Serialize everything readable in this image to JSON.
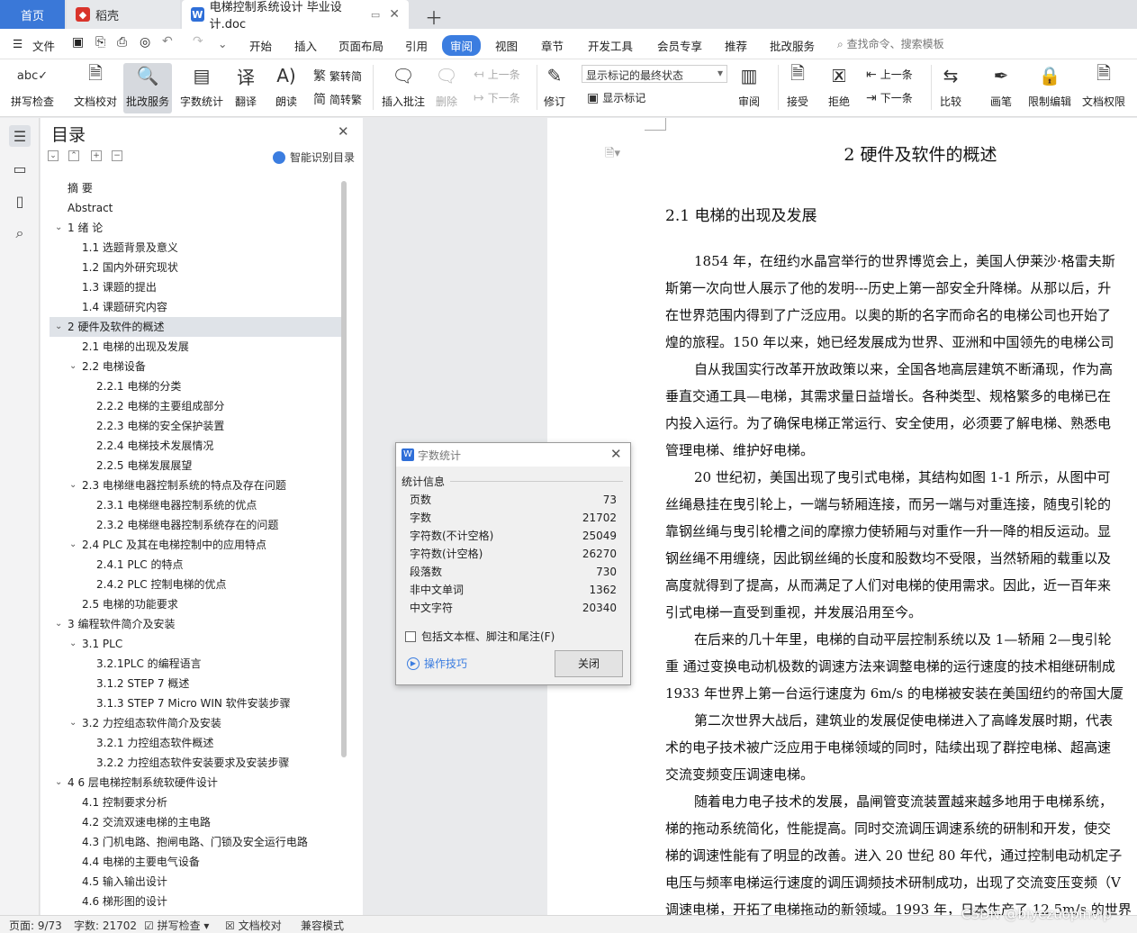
{
  "tabs": {
    "home": "首页",
    "daoke": "稻壳",
    "doc": "电梯控制系统设计 毕业设计.doc"
  },
  "menu": {
    "file": "文件",
    "items": [
      "开始",
      "插入",
      "页面布局",
      "引用",
      "审阅",
      "视图",
      "章节",
      "开发工具",
      "会员专享",
      "推荐",
      "批改服务"
    ],
    "active": "审阅",
    "search_placeholder": "查找命令、搜索模板"
  },
  "ribbon": {
    "spell_check": "拼写检查",
    "doc_proof": "文档校对",
    "correction_service": "批改服务",
    "word_count": "字数统计",
    "translate": "翻译",
    "read_aloud": "朗读",
    "trad_to_simp": "繁转简",
    "simp_to_trad": "简转繁",
    "insert_comment": "插入批注",
    "delete": "删除",
    "prev": "上一条",
    "next": "下一条",
    "revise": "修订",
    "markup_select": "显示标记的最终状态",
    "show_markup": "显示标记",
    "review": "审阅",
    "accept": "接受",
    "reject": "拒绝",
    "prev2": "上一条",
    "next2": "下一条",
    "compare": "比较",
    "pen": "画笔",
    "restrict_edit": "限制编辑",
    "doc_permission": "文档权限"
  },
  "toc": {
    "title": "目录",
    "smart": "智能识别目录",
    "items": [
      {
        "label": "摘  要",
        "level": 0,
        "arrow": ""
      },
      {
        "label": "Abstract",
        "level": 0,
        "arrow": ""
      },
      {
        "label": "1 绪 论",
        "level": 0,
        "arrow": "v"
      },
      {
        "label": "1.1 选题背景及意义",
        "level": 1,
        "arrow": ""
      },
      {
        "label": "1.2 国内外研究现状",
        "level": 1,
        "arrow": ""
      },
      {
        "label": "1.3 课题的提出",
        "level": 1,
        "arrow": ""
      },
      {
        "label": "1.4 课题研究内容",
        "level": 1,
        "arrow": ""
      },
      {
        "label": "2 硬件及软件的概述",
        "level": 0,
        "arrow": "v",
        "selected": true
      },
      {
        "label": "2.1  电梯的出现及发展",
        "level": 1,
        "arrow": ""
      },
      {
        "label": "2.2  电梯设备",
        "level": 1,
        "arrow": "v"
      },
      {
        "label": "2.2.1  电梯的分类",
        "level": 2,
        "arrow": ""
      },
      {
        "label": "2.2.2  电梯的主要组成部分",
        "level": 2,
        "arrow": ""
      },
      {
        "label": "2.2.3  电梯的安全保护装置",
        "level": 2,
        "arrow": ""
      },
      {
        "label": "2.2.4  电梯技术发展情况",
        "level": 2,
        "arrow": ""
      },
      {
        "label": "2.2.5  电梯发展展望",
        "level": 2,
        "arrow": ""
      },
      {
        "label": "2.3 电梯继电器控制系统的特点及存在问题",
        "level": 1,
        "arrow": "v"
      },
      {
        "label": "2.3.1 电梯继电器控制系统的优点",
        "level": 2,
        "arrow": ""
      },
      {
        "label": "2.3.2 电梯继电器控制系统存在的问题",
        "level": 2,
        "arrow": ""
      },
      {
        "label": "2.4 PLC 及其在电梯控制中的应用特点",
        "level": 1,
        "arrow": "v"
      },
      {
        "label": "2.4.1 PLC  的特点",
        "level": 2,
        "arrow": ""
      },
      {
        "label": "2.4.2 PLC  控制电梯的优点",
        "level": 2,
        "arrow": ""
      },
      {
        "label": "2.5 电梯的功能要求",
        "level": 1,
        "arrow": ""
      },
      {
        "label": "3 编程软件简介及安装",
        "level": 0,
        "arrow": "v"
      },
      {
        "label": "3.1 PLC",
        "level": 1,
        "arrow": "v"
      },
      {
        "label": "3.2.1PLC 的编程语言",
        "level": 2,
        "arrow": ""
      },
      {
        "label": "3.1.2 STEP 7 概述",
        "level": 2,
        "arrow": ""
      },
      {
        "label": "3.1.3 STEP 7 Micro WIN 软件安装步骤",
        "level": 2,
        "arrow": ""
      },
      {
        "label": "3.2 力控组态软件简介及安装",
        "level": 1,
        "arrow": "v"
      },
      {
        "label": "3.2.1 力控组态软件概述",
        "level": 2,
        "arrow": ""
      },
      {
        "label": "3.2.2 力控组态软件安装要求及安装步骤",
        "level": 2,
        "arrow": ""
      },
      {
        "label": "4 6 层电梯控制系统软硬件设计",
        "level": 0,
        "arrow": "v"
      },
      {
        "label": "4.1 控制要求分析",
        "level": 1,
        "arrow": ""
      },
      {
        "label": "4.2 交流双速电梯的主电路",
        "level": 1,
        "arrow": ""
      },
      {
        "label": "4.3 门机电路、抱闸电路、门锁及安全运行电路",
        "level": 1,
        "arrow": ""
      },
      {
        "label": "4.4 电梯的主要电气设备",
        "level": 1,
        "arrow": ""
      },
      {
        "label": "4.5 输入输出设计",
        "level": 1,
        "arrow": ""
      },
      {
        "label": "4.6 梯形图的设计",
        "level": 1,
        "arrow": ""
      }
    ]
  },
  "document": {
    "chapter_title": "2 硬件及软件的概述",
    "section_title": "2.1  电梯的出现及发展",
    "lines": [
      {
        "text": "1854 年，在纽约水晶宫举行的世界博览会上，美国人伊莱沙·格雷夫斯",
        "indent": true
      },
      {
        "text": "斯第一次向世人展示了他的发明---历史上第一部安全升降梯。从那以后，升",
        "indent": false
      },
      {
        "text": "在世界范围内得到了广泛应用。以奥的斯的名字而命名的电梯公司也开始了",
        "indent": false
      },
      {
        "text": "煌的旅程。150 年以来，她已经发展成为世界、亚洲和中国领先的电梯公司",
        "indent": false
      },
      {
        "text": "自从我国实行改革开放政策以来，全国各地高层建筑不断涌现，作为高",
        "indent": true
      },
      {
        "text": "垂直交通工具—电梯，其需求量日益增长。各种类型、规格繁多的电梯已在",
        "indent": false
      },
      {
        "text": "内投入运行。为了确保电梯正常运行、安全使用，必须要了解电梯、熟悉电",
        "indent": false
      },
      {
        "text": "管理电梯、维护好电梯。",
        "indent": false
      },
      {
        "text": " 20 世纪初，美国出现了曳引式电梯，其结构如图 1-1 所示，从图中可",
        "indent": true
      },
      {
        "text": "丝绳悬挂在曳引轮上，一端与轿厢连接，而另一端与对重连接，随曳引轮的",
        "indent": false
      },
      {
        "text": "靠钢丝绳与曳引轮槽之间的摩擦力使轿厢与对重作一升一降的相反运动。显",
        "indent": false
      },
      {
        "text": "钢丝绳不用缠绕，因此钢丝绳的长度和股数均不受限，当然轿厢的载重以及",
        "indent": false
      },
      {
        "text": "高度就得到了提高，从而满足了人们对电梯的使用需求。因此，近一百年来",
        "indent": false
      },
      {
        "text": "引式电梯一直受到重视，并发展沿用至今。",
        "indent": false
      },
      {
        "text": "在后来的几十年里，电梯的自动平层控制系统以及 1—轿厢  2—曳引轮",
        "indent": true
      },
      {
        "text": "重  通过变换电动机极数的调速方法来调整电梯的运行速度的技术相继研制成",
        "indent": false
      },
      {
        "text": "1933 年世界上第一台运行速度为 6m/s 的电梯被安装在美国纽约的帝国大厦",
        "indent": false
      },
      {
        "text": "第二次世界大战后，建筑业的发展促使电梯进入了高峰发展时期，代表",
        "indent": true
      },
      {
        "text": "术的电子技术被广泛应用于电梯领域的同时，陆续出现了群控电梯、超高速",
        "indent": false
      },
      {
        "text": "交流变频变压调速电梯。",
        "indent": false
      },
      {
        "text": "随着电力电子技术的发展，晶闸管变流装置越来越多地用于电梯系统，",
        "indent": true
      },
      {
        "text": "梯的拖动系统简化，性能提高。同时交流调压调速系统的研制和开发，使交",
        "indent": false
      },
      {
        "text": "梯的调速性能有了明显的改善。进入 20 世纪 80 年代，通过控制电动机定子",
        "indent": false
      },
      {
        "text": "电压与频率电梯运行速度的调压调频技术研制成功，出现了交流变压变频（V",
        "indent": false
      },
      {
        "text": "调速电梯，开拓了电梯拖动的新领域。1993 年，日本生产了 12.5m/s 的世界",
        "indent": false
      }
    ]
  },
  "dialog": {
    "title": "字数统计",
    "group": "统计信息",
    "stats": [
      {
        "label": "页数",
        "value": "73"
      },
      {
        "label": "字数",
        "value": "21702"
      },
      {
        "label": "字符数(不计空格)",
        "value": "25049"
      },
      {
        "label": "字符数(计空格)",
        "value": "26270"
      },
      {
        "label": "段落数",
        "value": "730"
      },
      {
        "label": "非中文单词",
        "value": "1362"
      },
      {
        "label": "中文字符",
        "value": "20340"
      }
    ],
    "checkbox": "包括文本框、脚注和尾注(F)",
    "tips": "操作技巧",
    "close": "关闭"
  },
  "status": {
    "page": "页面: 9/73",
    "words": "字数: 21702",
    "spell": "拼写检查",
    "proof": "文档校对",
    "compat": "兼容模式"
  },
  "watermark": "CSDN @biyezuopinvip",
  "colors": {
    "accent": "#3b7de0",
    "home_tab": "#3a78d8"
  }
}
